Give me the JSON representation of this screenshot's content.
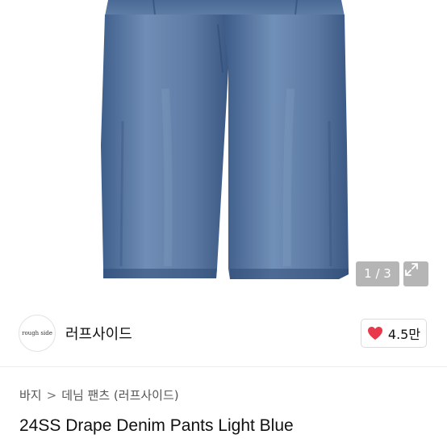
{
  "gallery": {
    "image": "light-blue-denim-pants-photo",
    "counter": "1 / 3",
    "expand_icon": "expand-arrows-icon"
  },
  "seller": {
    "logo_text": "rough side",
    "name": "러프사이드",
    "like_count": "4.5만",
    "like_icon": "heart-icon",
    "like_color": "#e8394a"
  },
  "breadcrumb": {
    "level1": "바지",
    "separator": ">",
    "level2": "데님 팬츠 (러프사이드)"
  },
  "product": {
    "title": "24SS Drape Denim Pants Light Blue"
  }
}
